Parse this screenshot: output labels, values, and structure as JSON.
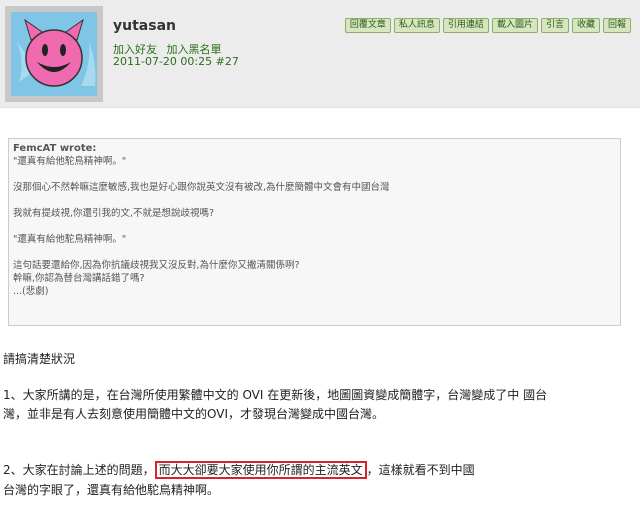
{
  "post": {
    "username": "yutasan",
    "add_friend": "加入好友",
    "add_blacklist": "加入黑名單",
    "date": "2011-07-20 00:25",
    "post_number": "#27"
  },
  "toolbar": {
    "buttons": [
      "回覆文章",
      "私人訊息",
      "引用連結",
      "載入圖片",
      "引言",
      "收藏",
      "回報"
    ]
  },
  "quote": {
    "author": "FemcAT wrote:",
    "lines": [
      "\"還真有給他駝鳥精神啊。\"",
      "",
      "沒那個心不然幹嘛這麼敏感,我也是好心跟你說英文沒有被改,為什麼簡體中文會有中國台灣",
      "",
      "我就有提歧視,你還引我的文,不就是想說歧視嗎?",
      "",
      "\"還真有給他駝鳥精神啊。\"",
      "",
      "這句話要還給你,因為你抗議歧視我又沒反對,為什麼你又撇清關係咧?",
      "幹嘛,你認為替台灣講話錯了嗎?",
      "...(悲劇)"
    ]
  },
  "body": {
    "line1": "請搞清楚狀況",
    "p1_line1": "1、大家所講的是，在台灣所使用繁體中文的 OVI 在更新後，地圖圖資變成簡體字，台灣變成了中 國台",
    "p1_line2": "灣，並非是有人去刻意使用簡體中文的OVI，才發現台灣變成中國台灣。",
    "p2_pre": "2、大家在討論上述的問題，",
    "p2_highlight": "而大大卻要大家使用你所謂的主流英文",
    "p2_post": "，這樣就看不到中國",
    "p2_line2": "台灣的字眼了，還真有給他駝鳥精神啊。"
  },
  "colors": {
    "header_bg": "#ececec",
    "link_green": "#2a6f1a",
    "button_bg": "#d6e6bf",
    "highlight_border": "#d9232a",
    "avatar_bg": "#7fc6e6",
    "avatar_face": "#f06ab0"
  },
  "icons": {
    "avatar": "pink-devil-smiley"
  }
}
